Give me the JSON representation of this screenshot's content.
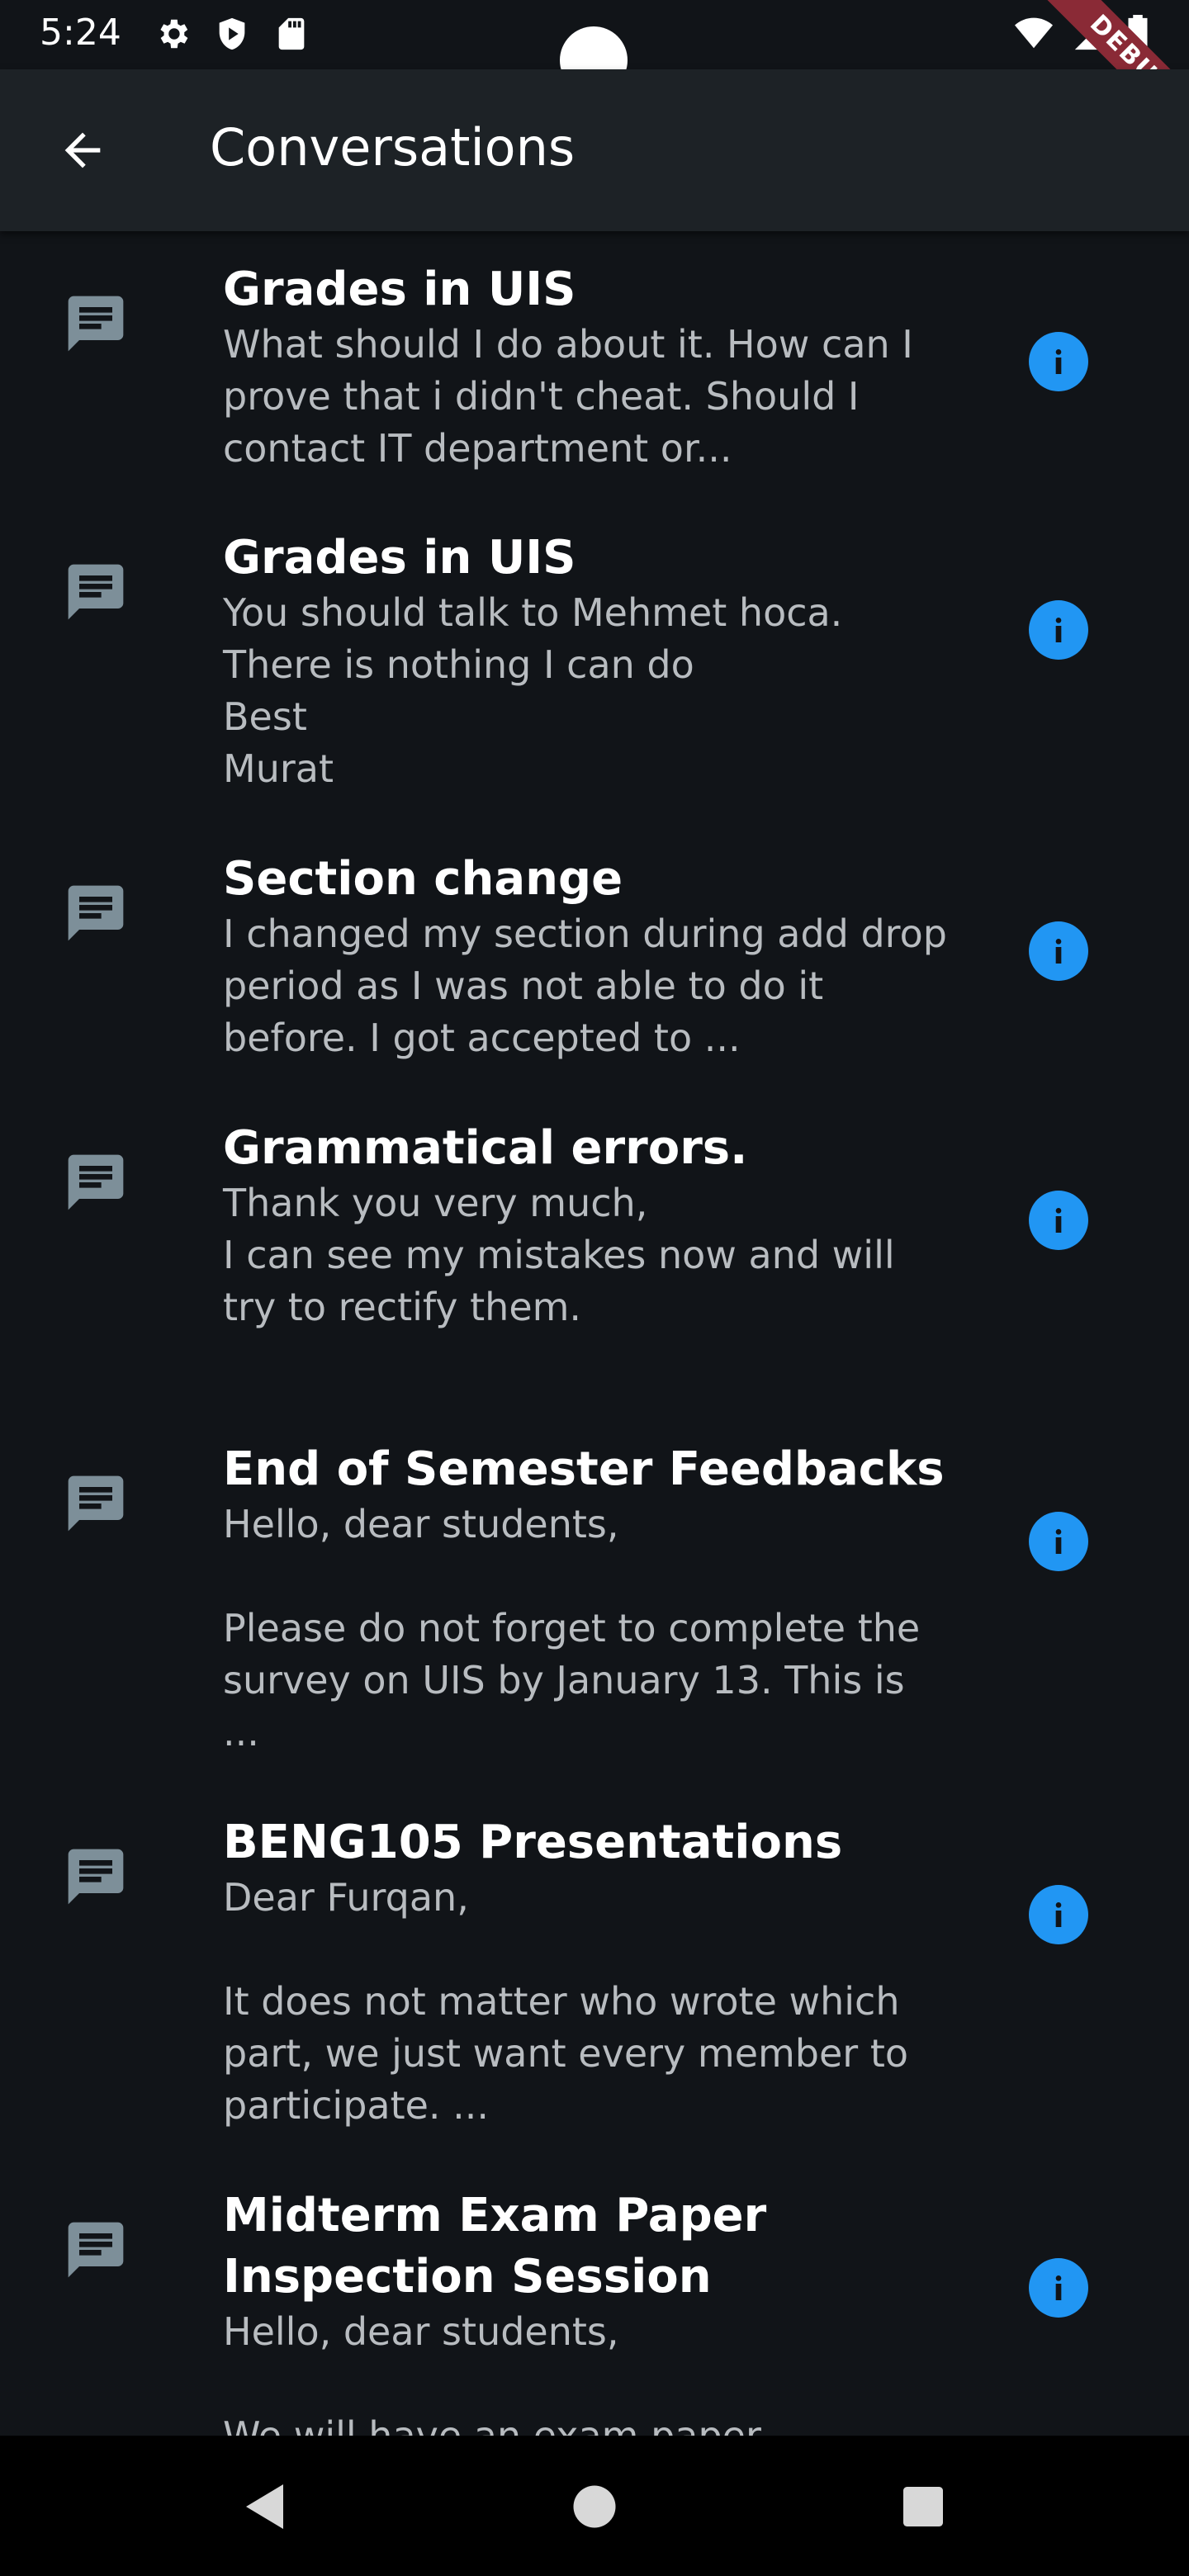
{
  "status_bar": {
    "time": "5:24",
    "debug_label": "DEBUG"
  },
  "app_bar": {
    "title": "Conversations"
  },
  "conversations": [
    {
      "title": "Grades in UIS",
      "preview": "What should I do about it. How can I prove that i didn't cheat. Should I contact IT department or..."
    },
    {
      "title": "Grades in UIS",
      "preview": "You should talk to Mehmet hoca.\nThere is nothing I can do\nBest\nMurat"
    },
    {
      "title": "Section change",
      "preview": "I changed my section during add drop period as I was not able to do it before. I got accepted to ..."
    },
    {
      "title": "Grammatical errors.",
      "preview": "Thank you very much,\nI can see my mistakes now and will try to rectify them."
    },
    {
      "title": "End of Semester Feedbacks",
      "preview": "Hello, dear students,\n\nPlease do not forget to complete the survey on UIS by January 13. This is ..."
    },
    {
      "title": "BENG105 Presentations",
      "preview": "Dear Furqan,\n\nIt does not matter who wrote which part, we just want every member to participate. ..."
    },
    {
      "title": "Midterm Exam Paper Inspection Session",
      "preview": "Hello, dear students,\n\nWe will have an exam paper"
    }
  ],
  "colors": {
    "accent": "#2196f3",
    "icon_gray": "#7d8f99",
    "background": "#111418",
    "app_bar": "#1d2226"
  }
}
